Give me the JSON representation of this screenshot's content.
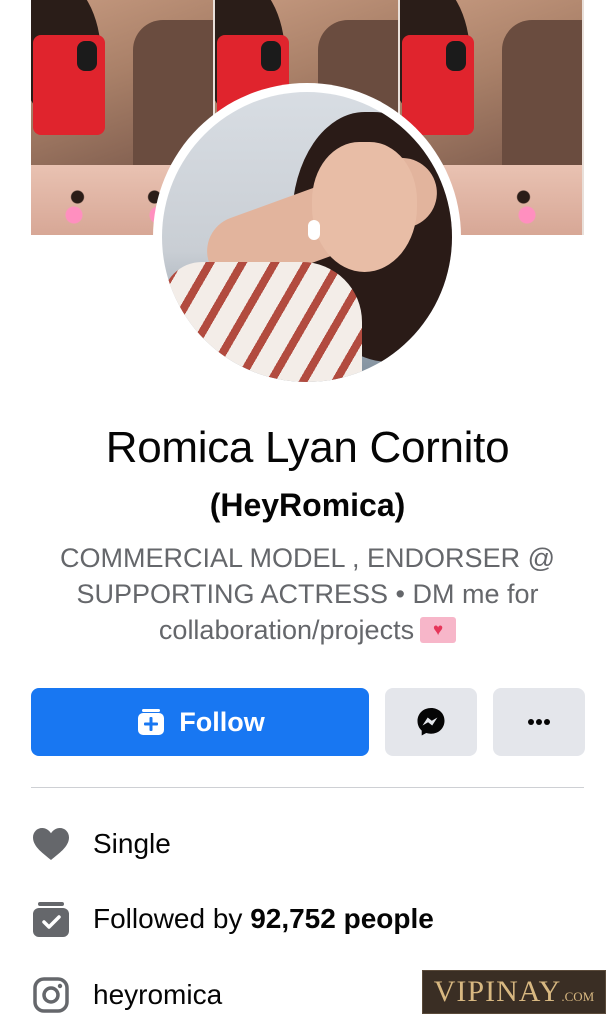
{
  "profile": {
    "name": "Romica Lyan Cornito",
    "alias": "(HeyRomica)",
    "bio": "COMMERCIAL MODEL , ENDORSER @ SUPPORTING ACTRESS • DM me for collaboration/projects",
    "bio_emoji": "love-letter-emoji"
  },
  "actions": {
    "follow_label": "Follow",
    "follow_icon": "follow-add-icon",
    "message_icon": "messenger-icon",
    "more_icon": "more-dots-icon"
  },
  "info": {
    "relationship": {
      "icon": "heart-icon",
      "text": "Single"
    },
    "followers": {
      "icon": "followers-icon",
      "prefix": "Followed by ",
      "count": "92,752 people"
    },
    "instagram": {
      "icon": "instagram-icon",
      "text": "heyromica"
    }
  },
  "watermark": {
    "brand": "VIPINAY",
    "suffix": ".COM"
  },
  "colors": {
    "primary": "#1877f2",
    "secondary_button": "#e4e6eb",
    "text_primary": "#050505",
    "text_secondary": "#65676b",
    "icon_gray": "#65676b"
  }
}
